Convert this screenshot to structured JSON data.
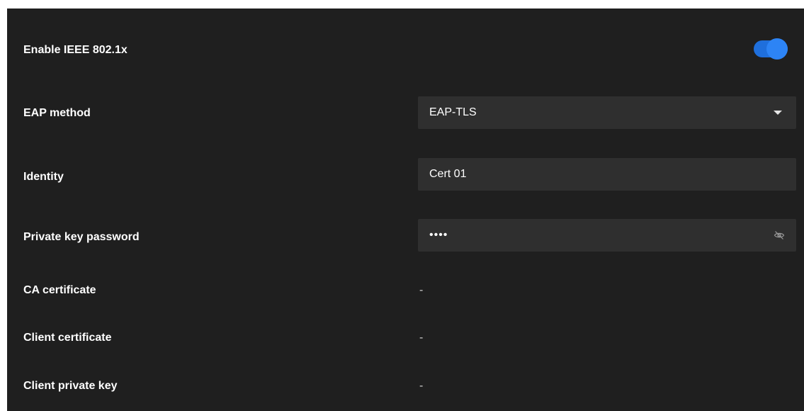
{
  "settings": {
    "enable_8021x": {
      "label": "Enable IEEE 802.1x",
      "enabled": true
    },
    "eap_method": {
      "label": "EAP method",
      "value": "EAP-TLS"
    },
    "identity": {
      "label": "Identity",
      "value": "Cert 01"
    },
    "private_key_password": {
      "label": "Private key password",
      "value": "••••",
      "icon": "eye-slash-icon"
    },
    "ca_certificate": {
      "label": "CA certificate",
      "value": "-"
    },
    "client_certificate": {
      "label": "Client certificate",
      "value": "-"
    },
    "client_private_key": {
      "label": "Client private key",
      "value": "-"
    }
  },
  "colors": {
    "panel_bg": "#1f1f1f",
    "field_bg": "#2f2f2f",
    "accent": "#2d84f5"
  }
}
